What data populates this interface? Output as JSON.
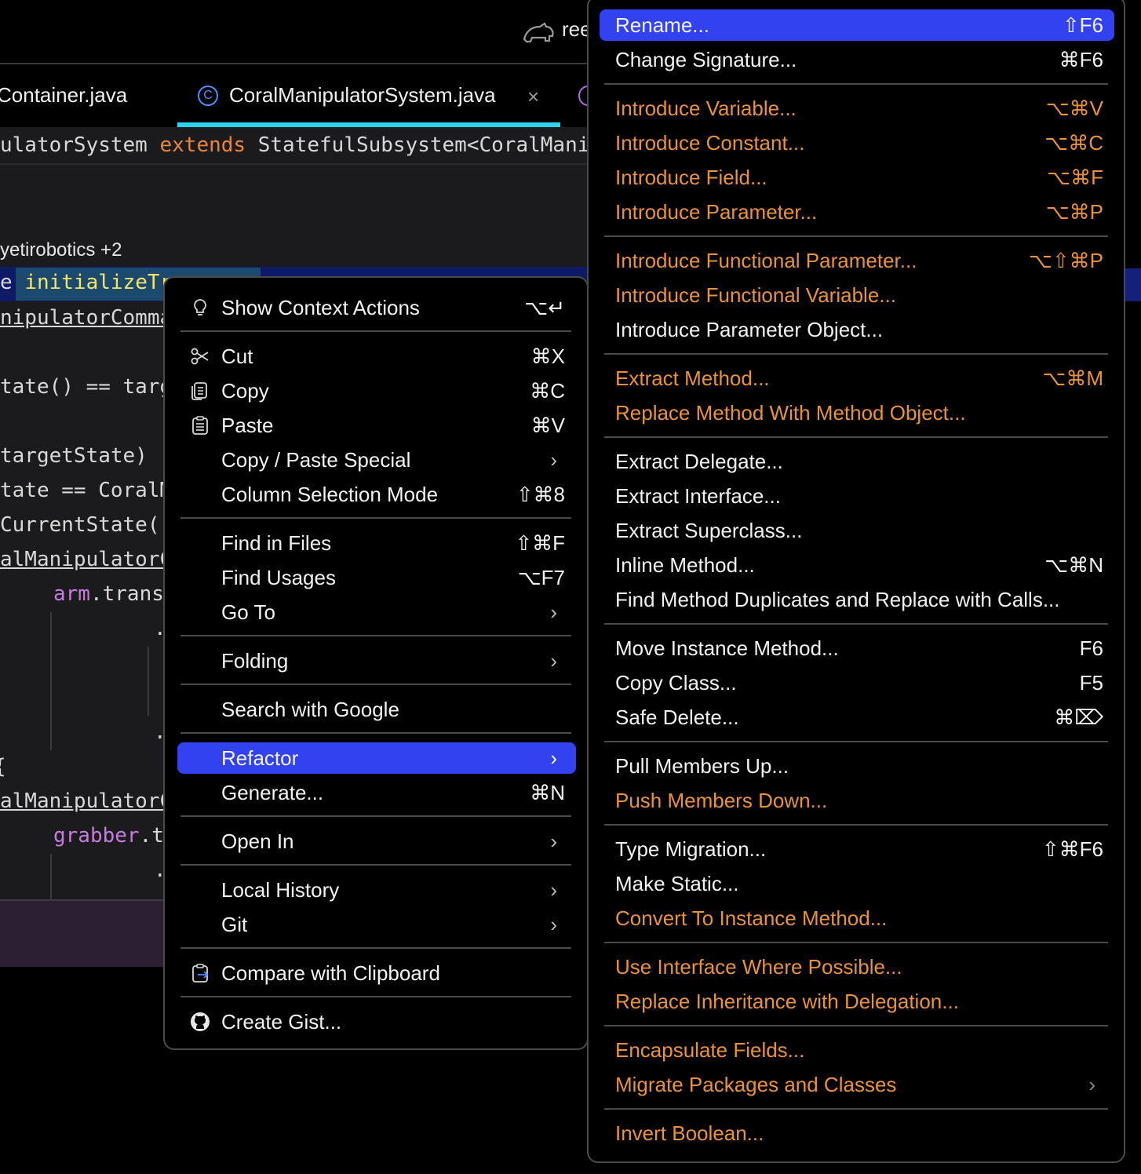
{
  "window": {
    "project_name": "ree"
  },
  "tabs": [
    {
      "label": "Container.java"
    },
    {
      "label": "CoralManipulatorSystem.java",
      "icon_letter": "C",
      "active": true
    }
  ],
  "editor": {
    "lines": {
      "class_decl_a": "ulatorSystem ",
      "class_decl_kw": "extends",
      "class_decl_b": " StatefulSubsystem<CoralManip",
      "author": "yetirobotics +2",
      "method_prefix": "e ",
      "method_name": "initializeTr",
      "l1": "nipulatorComma",
      "l2": "tate() == targ",
      "l3": "targetState) |",
      "l4": "tate == CoralM",
      "l5": "CurrentState()",
      "l6": "alManipulatorC",
      "l7_var": "arm",
      "l7_rest": ".trans",
      "l8": "{",
      "l9": "alManipulatorC",
      "l10_var": "grabber",
      "l10_rest": ".t",
      "dot": "."
    }
  },
  "context_menu": {
    "items": [
      {
        "id": "show-context-actions",
        "label": "Show Context Actions",
        "shortcut": "⌥↵",
        "icon": "lightbulb-icon"
      },
      {
        "id": "cut",
        "label": "Cut",
        "shortcut": "⌘X",
        "icon": "scissors-icon"
      },
      {
        "id": "copy",
        "label": "Copy",
        "shortcut": "⌘C",
        "icon": "copy-icon"
      },
      {
        "id": "paste",
        "label": "Paste",
        "shortcut": "⌘V",
        "icon": "clipboard-icon"
      },
      {
        "id": "copy-paste-special",
        "label": "Copy / Paste Special",
        "submenu": true
      },
      {
        "id": "column-selection-mode",
        "label": "Column Selection Mode",
        "shortcut": "⇧⌘8"
      },
      {
        "id": "find-in-files",
        "label": "Find in Files",
        "shortcut": "⇧⌘F"
      },
      {
        "id": "find-usages",
        "label": "Find Usages",
        "shortcut": "⌥F7"
      },
      {
        "id": "go-to",
        "label": "Go To",
        "submenu": true
      },
      {
        "id": "folding",
        "label": "Folding",
        "submenu": true
      },
      {
        "id": "search-with-google",
        "label": "Search with Google"
      },
      {
        "id": "refactor",
        "label": "Refactor",
        "submenu": true,
        "selected": true
      },
      {
        "id": "generate",
        "label": "Generate...",
        "shortcut": "⌘N"
      },
      {
        "id": "open-in",
        "label": "Open In",
        "submenu": true
      },
      {
        "id": "local-history",
        "label": "Local History",
        "submenu": true
      },
      {
        "id": "git",
        "label": "Git",
        "submenu": true
      },
      {
        "id": "compare-with-clipboard",
        "label": "Compare with Clipboard",
        "icon": "compare-clipboard-icon"
      },
      {
        "id": "create-gist",
        "label": "Create Gist...",
        "icon": "github-icon"
      }
    ]
  },
  "refactor_menu": {
    "items": [
      {
        "id": "rename",
        "label": "Rename...",
        "shortcut": "⇧F6",
        "selected": true
      },
      {
        "id": "change-signature",
        "label": "Change Signature...",
        "shortcut": "⌘F6"
      },
      {
        "id": "introduce-variable",
        "label": "Introduce Variable...",
        "shortcut": "⌥⌘V",
        "disabled": true
      },
      {
        "id": "introduce-constant",
        "label": "Introduce Constant...",
        "shortcut": "⌥⌘C",
        "disabled": true
      },
      {
        "id": "introduce-field",
        "label": "Introduce Field...",
        "shortcut": "⌥⌘F",
        "disabled": true
      },
      {
        "id": "introduce-parameter",
        "label": "Introduce Parameter...",
        "shortcut": "⌥⌘P",
        "disabled": true
      },
      {
        "id": "introduce-functional-parameter",
        "label": "Introduce Functional Parameter...",
        "shortcut": "⌥⇧⌘P",
        "disabled": true
      },
      {
        "id": "introduce-functional-variable",
        "label": "Introduce Functional Variable...",
        "disabled": true
      },
      {
        "id": "introduce-parameter-object",
        "label": "Introduce Parameter Object..."
      },
      {
        "id": "extract-method",
        "label": "Extract Method...",
        "shortcut": "⌥⌘M",
        "disabled": true
      },
      {
        "id": "replace-method-with-method-object",
        "label": "Replace Method With Method Object...",
        "disabled": true
      },
      {
        "id": "extract-delegate",
        "label": "Extract Delegate..."
      },
      {
        "id": "extract-interface",
        "label": "Extract Interface..."
      },
      {
        "id": "extract-superclass",
        "label": "Extract Superclass..."
      },
      {
        "id": "inline-method",
        "label": "Inline Method...",
        "shortcut": "⌥⌘N"
      },
      {
        "id": "find-method-duplicates",
        "label": "Find Method Duplicates and Replace with Calls..."
      },
      {
        "id": "move-instance-method",
        "label": "Move Instance Method...",
        "shortcut": "F6"
      },
      {
        "id": "copy-class",
        "label": "Copy Class...",
        "shortcut": "F5"
      },
      {
        "id": "safe-delete",
        "label": "Safe Delete...",
        "shortcut": "⌘⌦"
      },
      {
        "id": "pull-members-up",
        "label": "Pull Members Up..."
      },
      {
        "id": "push-members-down",
        "label": "Push Members Down...",
        "disabled": true
      },
      {
        "id": "type-migration",
        "label": "Type Migration...",
        "shortcut": "⇧⌘F6"
      },
      {
        "id": "make-static",
        "label": "Make Static..."
      },
      {
        "id": "convert-to-instance-method",
        "label": "Convert To Instance Method...",
        "disabled": true
      },
      {
        "id": "use-interface-where-possible",
        "label": "Use Interface Where Possible...",
        "disabled": true
      },
      {
        "id": "replace-inheritance-with-delegation",
        "label": "Replace Inheritance with Delegation...",
        "disabled": true
      },
      {
        "id": "encapsulate-fields",
        "label": "Encapsulate Fields...",
        "disabled": true
      },
      {
        "id": "migrate-packages-and-classes",
        "label": "Migrate Packages and Classes",
        "submenu": true,
        "disabled": true
      },
      {
        "id": "invert-boolean",
        "label": "Invert Boolean...",
        "disabled": true
      }
    ]
  },
  "colors": {
    "selection": "#3342f0",
    "disabled_text": "#e9923c",
    "tab_underline": "#2bd3ec",
    "keyword": "#e8873a",
    "field": "#c77ddd"
  }
}
